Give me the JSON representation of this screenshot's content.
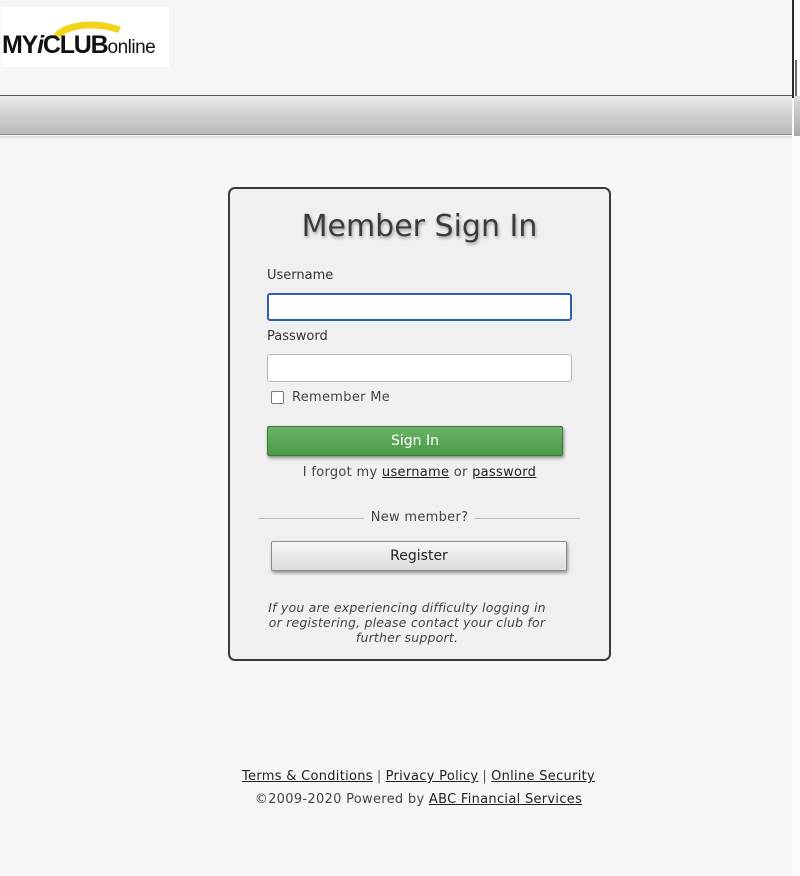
{
  "header": {
    "logo": {
      "text_my": "MY",
      "text_i": "i",
      "text_club": "CLUB",
      "text_online": "online",
      "accent_color": "#f2d51a"
    }
  },
  "login": {
    "title": "Member Sign In",
    "username_label": "Username",
    "username_value": "",
    "password_label": "Password",
    "password_value": "",
    "remember_label": "Remember Me",
    "remember_checked": false,
    "signin_label": "Sign In",
    "signin_color": "#5aa755",
    "forgot_prefix": "I forgot my",
    "forgot_username": "username",
    "forgot_or": "or",
    "forgot_password": "password",
    "new_member": "New member?",
    "register_label": "Register",
    "help_text": "If you are experiencing difficulty logging in or registering, please contact your club for further support."
  },
  "footer": {
    "terms": "Terms & Conditions",
    "separator": "|",
    "privacy": "Privacy Policy",
    "security": "Online Security",
    "copyright_prefix": "©2009-2020 Powered by",
    "powered_by": "ABC Financial Services"
  }
}
